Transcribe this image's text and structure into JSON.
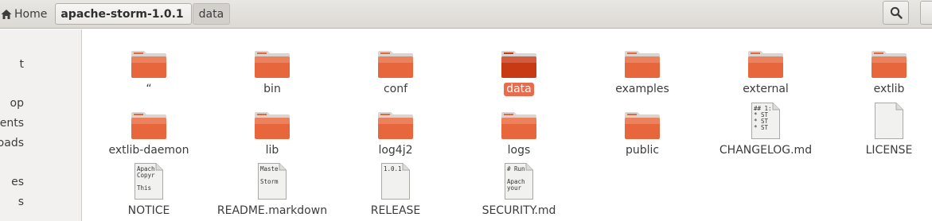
{
  "breadcrumb": {
    "home_label": "Home",
    "current_label": "apache-storm-1.0.1",
    "next_label": "data"
  },
  "sidebar": {
    "items": [
      {
        "label": "t"
      },
      {
        "label": "op"
      },
      {
        "label": "ments"
      },
      {
        "label": "oads"
      },
      {
        "label": "es"
      },
      {
        "label": "s"
      }
    ]
  },
  "colors": {
    "folder": "#e8663b",
    "folder_selected": "#c83a14",
    "selection": "#e96b4c"
  },
  "files": [
    {
      "name": "“",
      "type": "folder"
    },
    {
      "name": "bin",
      "type": "folder"
    },
    {
      "name": "conf",
      "type": "folder"
    },
    {
      "name": "data",
      "type": "folder",
      "selected": true
    },
    {
      "name": "examples",
      "type": "folder"
    },
    {
      "name": "external",
      "type": "folder"
    },
    {
      "name": "extlib",
      "type": "folder"
    },
    {
      "name": "extlib-daemon",
      "type": "folder"
    },
    {
      "name": "lib",
      "type": "folder"
    },
    {
      "name": "log4j2",
      "type": "folder"
    },
    {
      "name": "logs",
      "type": "folder"
    },
    {
      "name": "public",
      "type": "folder"
    },
    {
      "name": "CHANGELOG.md",
      "type": "text",
      "preview": [
        "## 1:",
        " * ST",
        " * ST",
        " * ST"
      ]
    },
    {
      "name": "LICENSE",
      "type": "blank"
    },
    {
      "name": "NOTICE",
      "type": "text",
      "preview": [
        "Apach",
        "Copyr",
        "",
        "This"
      ]
    },
    {
      "name": "README.markdown",
      "type": "text",
      "preview": [
        "Maste",
        "",
        "Storm"
      ]
    },
    {
      "name": "RELEASE",
      "type": "text",
      "preview": [
        "1.0.1"
      ]
    },
    {
      "name": "SECURITY.md",
      "type": "text",
      "preview": [
        "# Run",
        "",
        "Apach",
        "your"
      ]
    }
  ]
}
